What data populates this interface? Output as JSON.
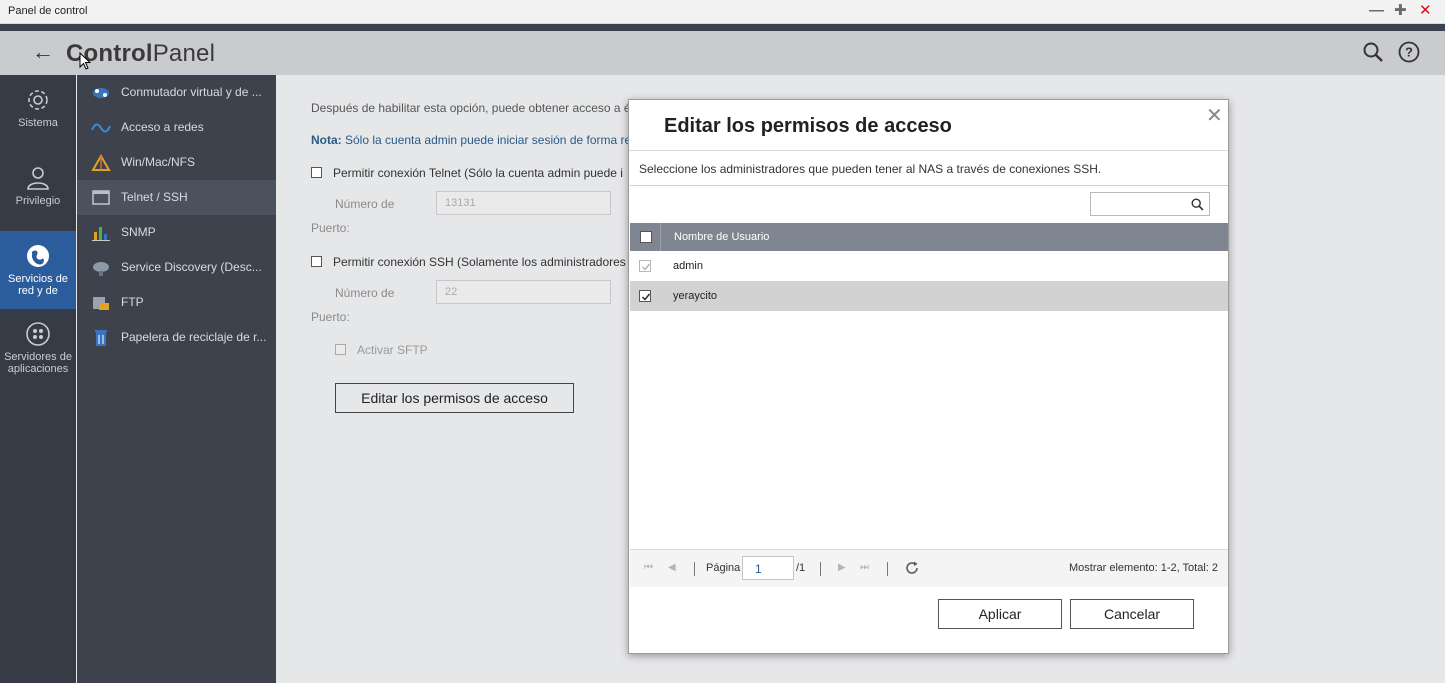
{
  "window": {
    "title": "Panel de control",
    "minimize_icon": "minimize-icon",
    "maximize_icon": "maximize-icon",
    "close_icon": "close-icon"
  },
  "header": {
    "brand_bold": "Control",
    "brand_light": "Panel",
    "back_icon": "arrow-left-icon",
    "search_icon": "search-icon",
    "help_icon": "help-icon"
  },
  "rail": [
    {
      "label": "Sistema",
      "icon": "gear-icon"
    },
    {
      "label": "Privilegio",
      "icon": "user-icon"
    },
    {
      "label": "Servicios de red y de",
      "icon": "globe-icon",
      "active": true
    },
    {
      "label": "Servidores de aplicaciones",
      "icon": "apps-grid-icon"
    }
  ],
  "subnav": [
    {
      "label": "Conmutador virtual y de ...",
      "icon": "network-switch-icon"
    },
    {
      "label": "Acceso a redes",
      "icon": "wave-icon"
    },
    {
      "label": "Win/Mac/NFS",
      "icon": "triangle-icon"
    },
    {
      "label": "Telnet / SSH",
      "icon": "terminal-icon",
      "active": true
    },
    {
      "label": "SNMP",
      "icon": "bar-chart-icon"
    },
    {
      "label": "Service Discovery (Desc...",
      "icon": "satellite-icon"
    },
    {
      "label": "FTP",
      "icon": "folder-icon"
    },
    {
      "label": "Papelera de reciclaje de r...",
      "icon": "recycle-bin-icon"
    }
  ],
  "content": {
    "intro": "Después de habilitar esta opción, puede obtener acceso a é",
    "note_label": "Nota:",
    "note_text": " Sólo la cuenta admin puede iniciar sesión de forma re",
    "telnet_label": "Permitir conexión Telnet (Sólo la cuenta admin puede i",
    "port_label_1": "Número de",
    "port_label_2": "Puerto:",
    "telnet_port": "13131",
    "ssh_label": "Permitir conexión SSH (Solamente los administradores",
    "ssh_port": "22",
    "sftp_label": "Activar SFTP",
    "edit_button": "Editar los permisos de acceso"
  },
  "dialog": {
    "title": "Editar los permisos de acceso",
    "description": "Seleccione los administradores que pueden tener al NAS a través de conexiones SSH.",
    "search_placeholder": "",
    "column_header": "Nombre de Usuario",
    "rows": [
      {
        "name": "admin",
        "checked": true,
        "disabled": true
      },
      {
        "name": "yeraycito",
        "checked": true,
        "disabled": false,
        "selected": true
      }
    ],
    "pager": {
      "page_label": "Página",
      "page_value": "1",
      "total_pages": "/1",
      "display_info": "Mostrar elemento: 1-2, Total: 2"
    },
    "apply_button": "Aplicar",
    "cancel_button": "Cancelar"
  },
  "colors": {
    "rail_bg": "#363b45",
    "subnav_bg": "#3d424d",
    "active_rail": "#2b5d9c",
    "grid_header": "#7f8691",
    "close_red": "#d0121b",
    "note_blue": "#2a5a88"
  }
}
